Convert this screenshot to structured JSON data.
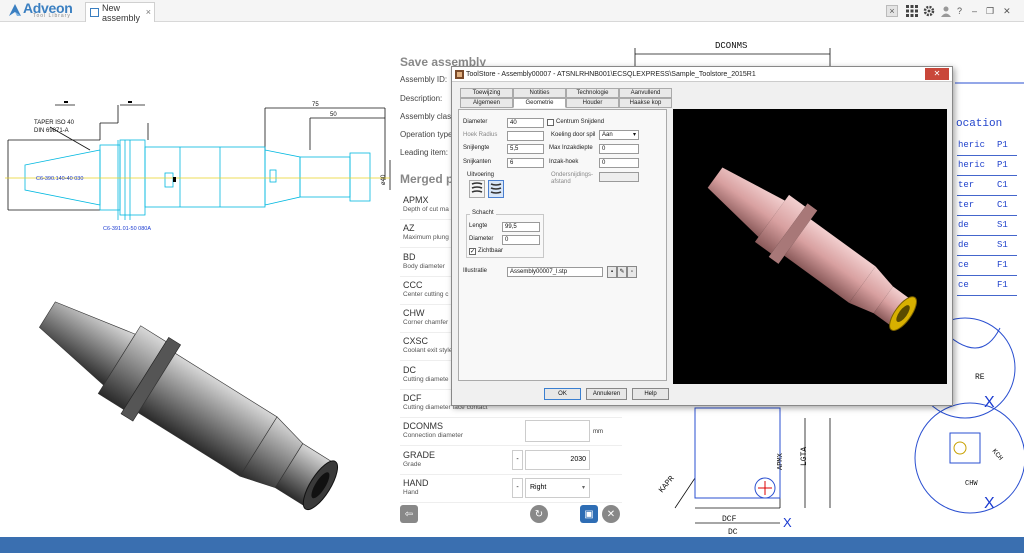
{
  "app": {
    "logo": "Adveon",
    "logo_sub": "Tool Library",
    "tab_title": "New assembly",
    "tab_close": "×"
  },
  "topbar_icons": [
    "close-icon",
    "grid-icon",
    "gear-icon",
    "user-icon",
    "help-icon",
    "minimize-icon",
    "restore-icon",
    "close-window-icon"
  ],
  "topbar": {
    "close": "×",
    "help": "?",
    "minimize": "–",
    "restore": "❐",
    "close_win": "✕"
  },
  "save": {
    "title": "Save assembly",
    "fields": [
      "Assembly ID:",
      "Description:",
      "Assembly classif",
      "Operation type:",
      "Leading item:"
    ]
  },
  "merged": {
    "title": "Merged p"
  },
  "properties": [
    {
      "code": "APMX",
      "desc": "Depth of cut ma"
    },
    {
      "code": "AZ",
      "desc": "Maximum plung"
    },
    {
      "code": "BD",
      "desc": "Body diameter"
    },
    {
      "code": "CCC",
      "desc": "Center cutting c"
    },
    {
      "code": "CHW",
      "desc": "Corner chamfer"
    },
    {
      "code": "CXSC",
      "desc": "Coolant exit style"
    },
    {
      "code": "DC",
      "desc": "Cutting diamete"
    },
    {
      "code": "DCF",
      "desc": "Cutting diameter face contact"
    },
    {
      "code": "DCONMS",
      "desc": "Connection diameter",
      "unit": "mm"
    },
    {
      "code": "GRADE",
      "desc": "Grade",
      "value": "2030",
      "minus": "-"
    },
    {
      "code": "HAND",
      "desc": "Hand",
      "value": "Right",
      "minus": "-"
    }
  ],
  "drawing": {
    "taper": "TAPER ISO 40",
    "din": "DIN 69871-A",
    "part1": "C6-390.140-40 030",
    "part2": "C6-391.01-50 080A",
    "dim75": "75",
    "dim50": "50",
    "dim_d40": "ø40",
    "dconms": "DCONMS",
    "location": "ocation",
    "lgta": "LGTA",
    "apmx": "APMX",
    "kapr": "KAPR",
    "dcf": "DCF",
    "dc": "DC",
    "re": "RE",
    "kch": "KCH",
    "chw": "CHW",
    "x": "X"
  },
  "location_rows": [
    {
      "a": "heric",
      "b": "P1"
    },
    {
      "a": "heric",
      "b": "P1"
    },
    {
      "a": "ter",
      "b": "C1"
    },
    {
      "a": "ter",
      "b": "C1"
    },
    {
      "a": "de",
      "b": "S1"
    },
    {
      "a": "de",
      "b": "S1"
    },
    {
      "a": "ce",
      "b": "F1"
    },
    {
      "a": "ce",
      "b": "F1"
    }
  ],
  "dialog": {
    "title": "ToolStore - Assembly00007 - ATSNLRHNB001\\ECSQLEXPRESS\\Sample_Toolstore_2015R1",
    "close": "✕",
    "tabs_row1": [
      "Toewijzing",
      "Notities",
      "Technologie",
      "Aanvullend"
    ],
    "tabs_row2": [
      "Algemeen",
      "Geometrie",
      "Houder",
      "Haakse kop"
    ],
    "active_tab": "Geometrie",
    "diameter_label": "Diameter",
    "diameter_value": "40",
    "centrum_label": "Centrum Snijdend",
    "hoek_label": "Hoek Radius",
    "koeling_label": "Koeling door spil",
    "koeling_value": "Aan",
    "snijlengte_label": "Snijlengte",
    "snijlengte_value": "5,5",
    "max_label": "Max Inzakdiepte",
    "max_value": "0",
    "snijkanten_label": "Snijkanten",
    "snijkanten_value": "6",
    "inzak_label": "Inzak-hoek",
    "inzak_value": "0",
    "uitvoering_label": "Uitvoering",
    "onder_label": "Ondersnijdings-afstand",
    "schacht_label": "Schacht",
    "lengte_label": "Lengte",
    "lengte_value": "99,5",
    "sdiam_label": "Diameter",
    "sdiam_value": "0",
    "zichtbaar_label": "Zichtbaar",
    "illustratie_label": "Illustratie",
    "illustratie_value": "Assembly00007_l.stp",
    "ok": "OK",
    "annuleren": "Annuleren",
    "help": "Help"
  },
  "colors": {
    "accent": "#3a6fb0",
    "cad_cyan": "#00c8e8",
    "cad_blue": "#2233aa",
    "preview_tool": "#e0a8a8"
  }
}
